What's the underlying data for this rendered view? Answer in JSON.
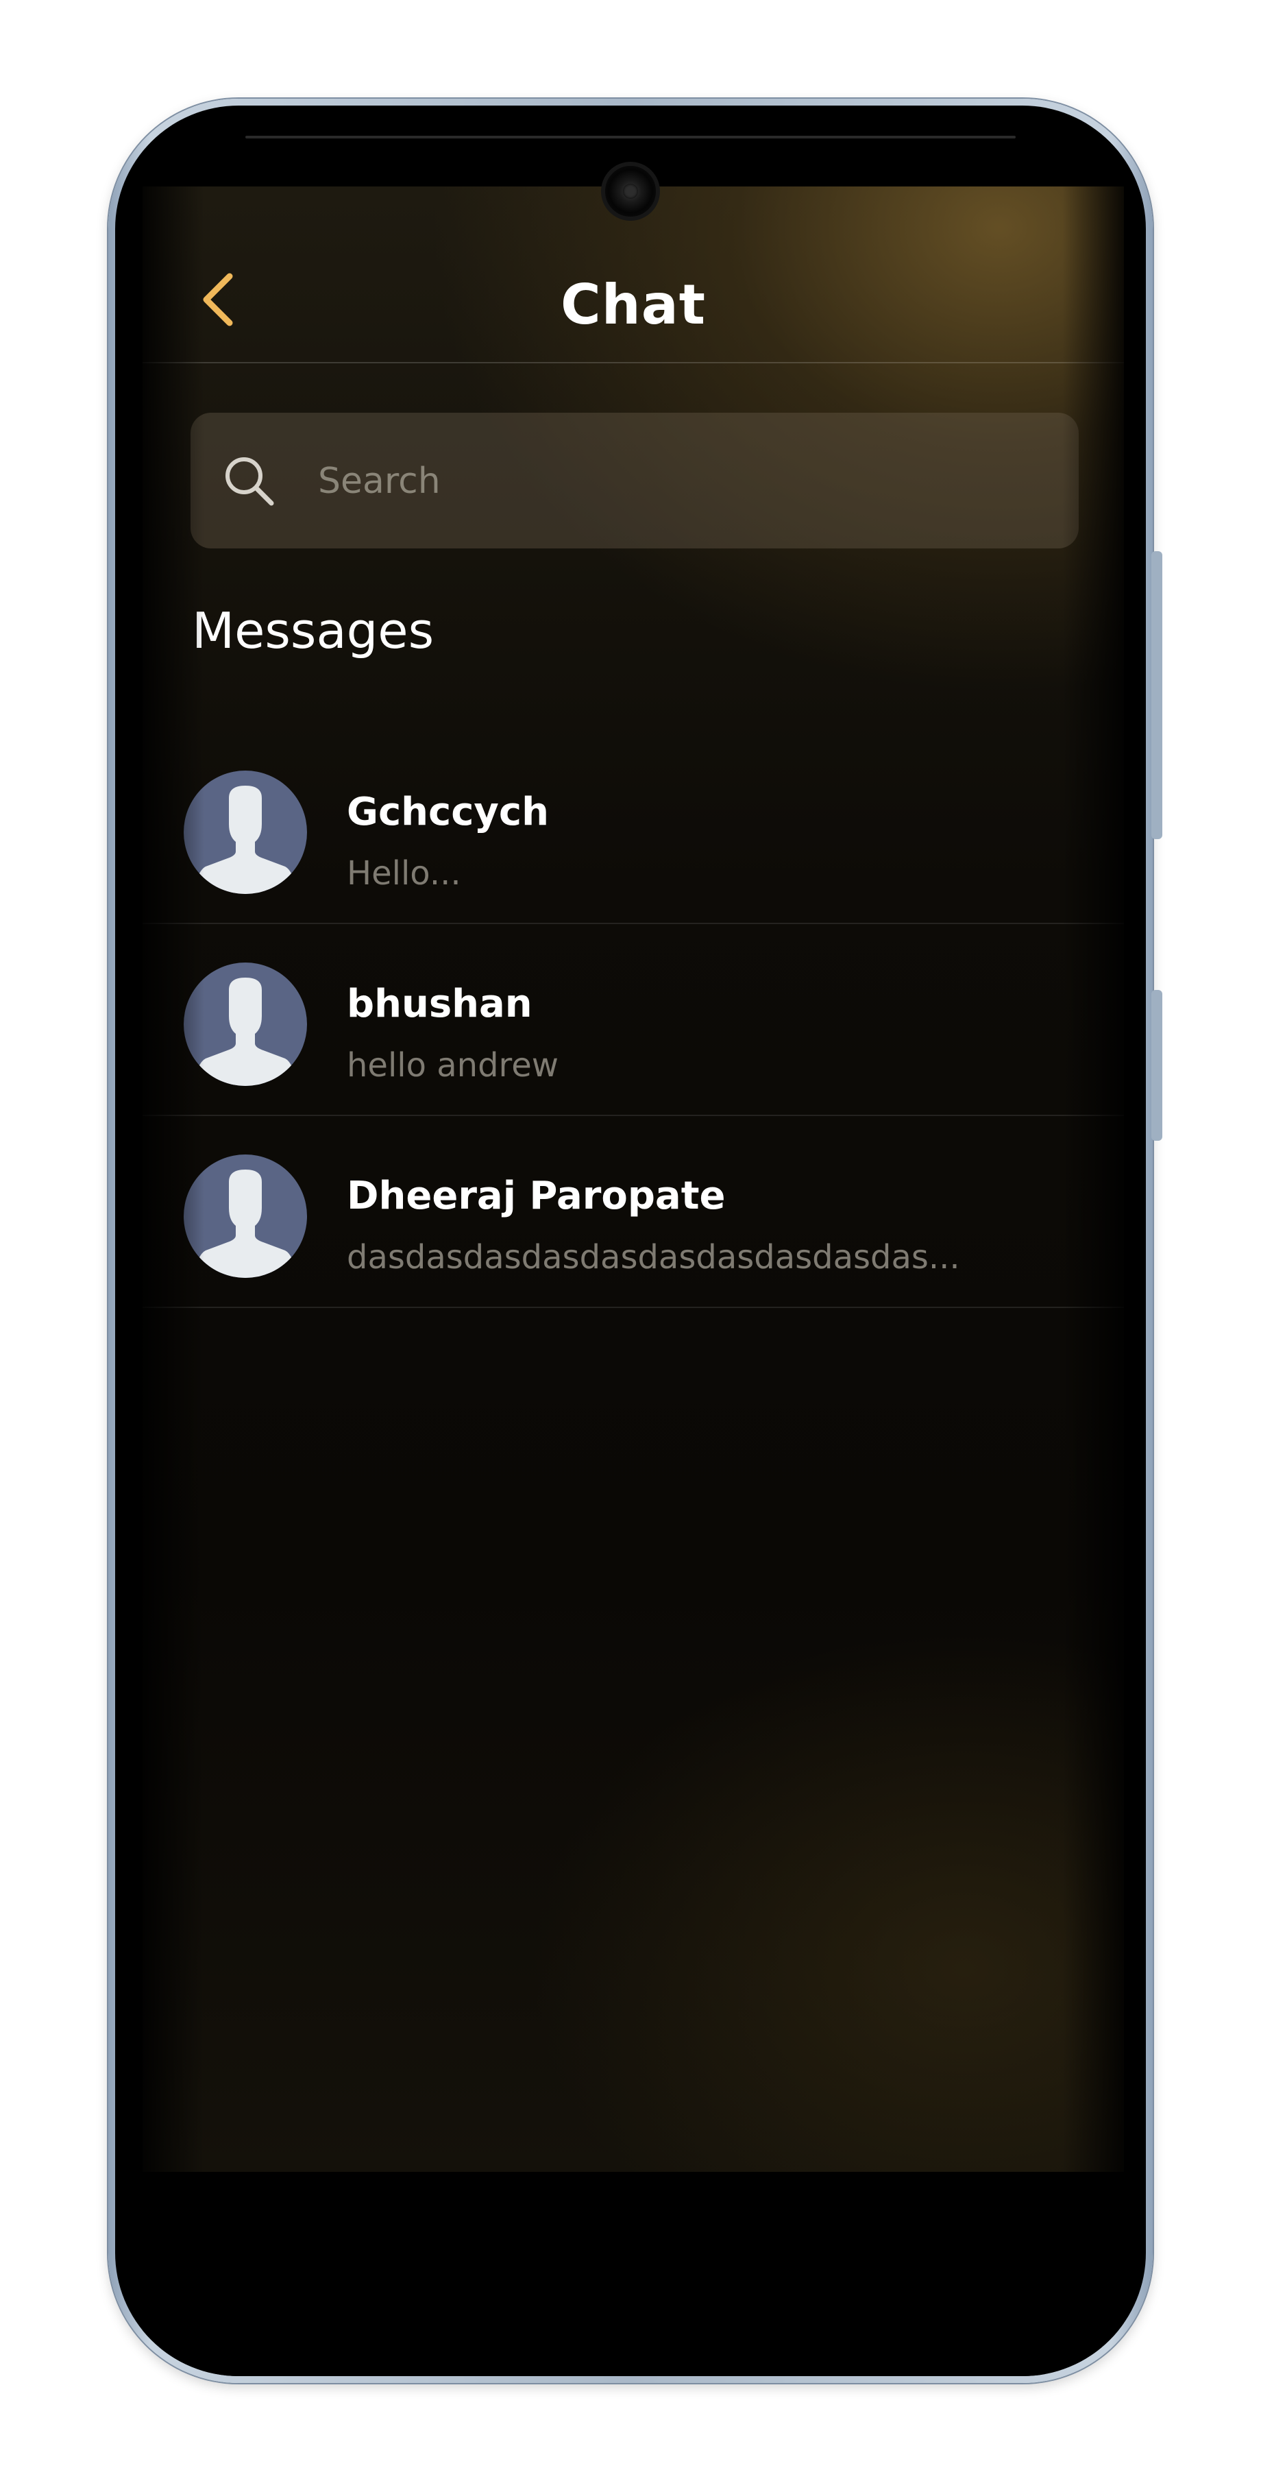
{
  "header": {
    "title": "Chat",
    "back_icon": "chevron-left-icon"
  },
  "search": {
    "placeholder": "Search",
    "value": "",
    "icon": "search-icon"
  },
  "messages_section": {
    "title": "Messages"
  },
  "chats": [
    {
      "name": "Gchccych",
      "preview": "Hello..."
    },
    {
      "name": "bhushan",
      "preview": "hello andrew"
    },
    {
      "name": "Dheeraj Paropate",
      "preview": "dasdasdasdasdasdasdasdasdasdas..."
    }
  ],
  "colors": {
    "accent": "#f0b85a",
    "background_dark": "#0a0805",
    "background_gold": "#705828",
    "avatar_bg": "#5a6585",
    "avatar_figure": "#e8ecef",
    "text_primary": "#ffffff",
    "text_secondary": "#7f7b72"
  }
}
